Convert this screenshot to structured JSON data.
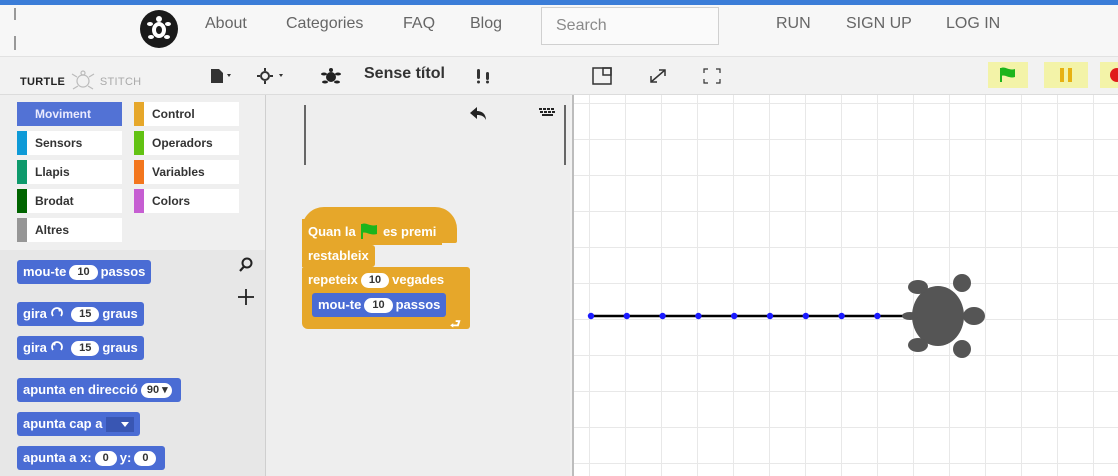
{
  "nav": {
    "links": [
      "About",
      "Categories",
      "FAQ",
      "Blog"
    ],
    "search_placeholder": "Search",
    "actions": [
      "RUN",
      "SIGN UP",
      "LOG IN"
    ]
  },
  "toolbar": {
    "brand_left": "TURTLE",
    "brand_right": "STITCH",
    "project_title": "Sense títol"
  },
  "categories": [
    {
      "label": "Moviment",
      "color": "#4a6cd4",
      "selected": true
    },
    {
      "label": "Control",
      "color": "#e6a72a"
    },
    {
      "label": "Sensors",
      "color": "#0e9ad7"
    },
    {
      "label": "Operadors",
      "color": "#62c213"
    },
    {
      "label": "Llapis",
      "color": "#0e9a6c"
    },
    {
      "label": "Variables",
      "color": "#f3761d"
    },
    {
      "label": "Brodat",
      "color": "#006400"
    },
    {
      "label": "Colors",
      "color": "#c65ed2"
    },
    {
      "label": "Altres",
      "color": "#969696"
    }
  ],
  "palette_blocks": {
    "move": {
      "pre": "mou-te",
      "val": "10",
      "post": "passos"
    },
    "turn_cw": {
      "pre": "gira",
      "val": "15",
      "post": "graus"
    },
    "turn_ccw": {
      "pre": "gira",
      "val": "15",
      "post": "graus"
    },
    "point_dir": {
      "pre": "apunta en direcció",
      "val": "90"
    },
    "point_to": {
      "pre": "apunta cap a"
    },
    "go_xy": {
      "pre": "apunta a x:",
      "x": "0",
      "mid": "y:",
      "y": "0"
    }
  },
  "script": {
    "hat": {
      "pre": "Quan la",
      "post": "es premi"
    },
    "reset": "restableix",
    "repeat": {
      "pre": "repeteix",
      "val": "10",
      "post": "vegades"
    },
    "move": {
      "pre": "mou-te",
      "val": "10",
      "post": "passos"
    }
  },
  "stage": {
    "line_color": "#000000",
    "point_color": "#1a1aff",
    "turtle_color": "#555555"
  }
}
